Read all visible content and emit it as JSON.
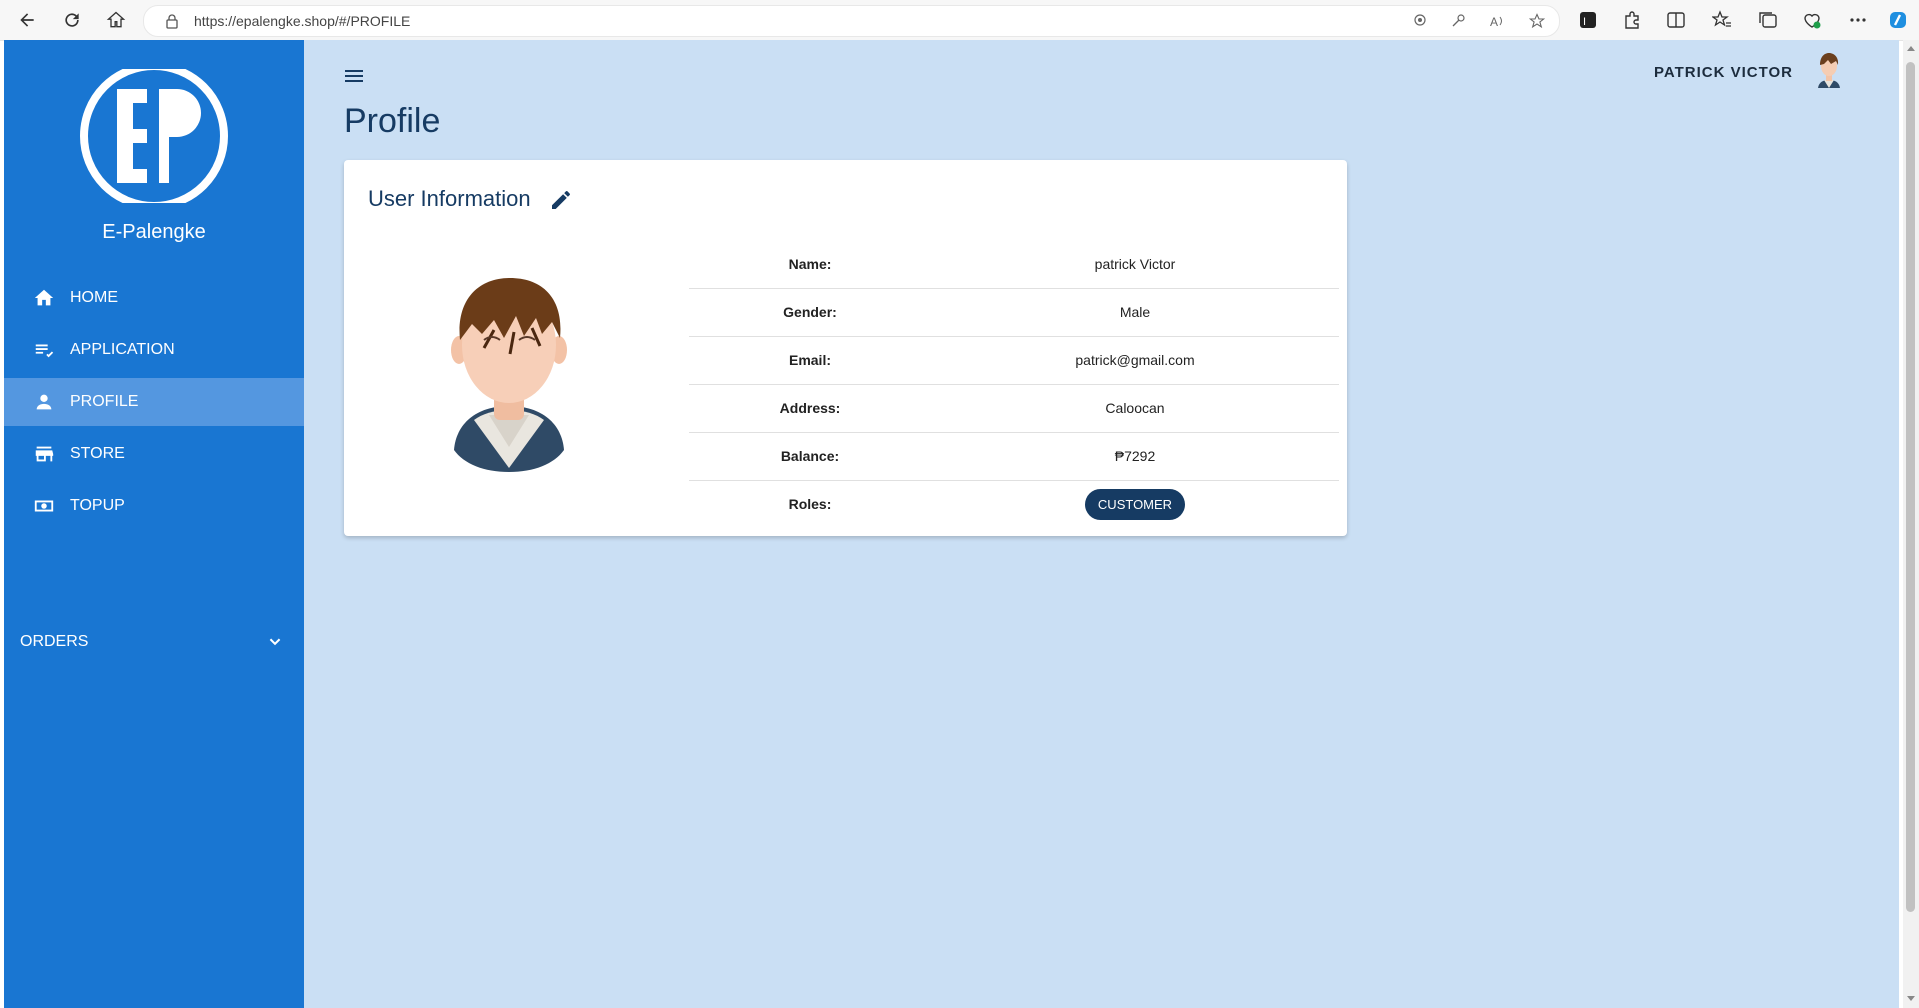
{
  "browser": {
    "url": "https://epalengke.shop/#/PROFILE"
  },
  "sidebar": {
    "brand": "E-Palengke",
    "items": [
      {
        "label": "HOME",
        "icon": "home-icon"
      },
      {
        "label": "APPLICATION",
        "icon": "playlist-check-icon"
      },
      {
        "label": "PROFILE",
        "icon": "person-icon",
        "active": true
      },
      {
        "label": "STORE",
        "icon": "store-icon"
      },
      {
        "label": "TOPUP",
        "icon": "money-icon"
      }
    ],
    "orders_label": "ORDERS"
  },
  "header": {
    "page_title": "Profile",
    "user_name": "PATRICK VICTOR"
  },
  "card": {
    "title": "User Information",
    "fields": [
      {
        "label": "Name:",
        "value": "patrick Victor"
      },
      {
        "label": "Gender:",
        "value": "Male"
      },
      {
        "label": "Email:",
        "value": "patrick@gmail.com"
      },
      {
        "label": "Address:",
        "value": "Caloocan"
      },
      {
        "label": "Balance:",
        "value": "₱7292"
      }
    ],
    "roles_label": "Roles:",
    "role_chip": "CUSTOMER"
  },
  "colors": {
    "sidebar": "#1976d2",
    "sidebar_active": "#5497e0",
    "main_bg": "#cadff4",
    "accent_dark": "#163b63"
  }
}
